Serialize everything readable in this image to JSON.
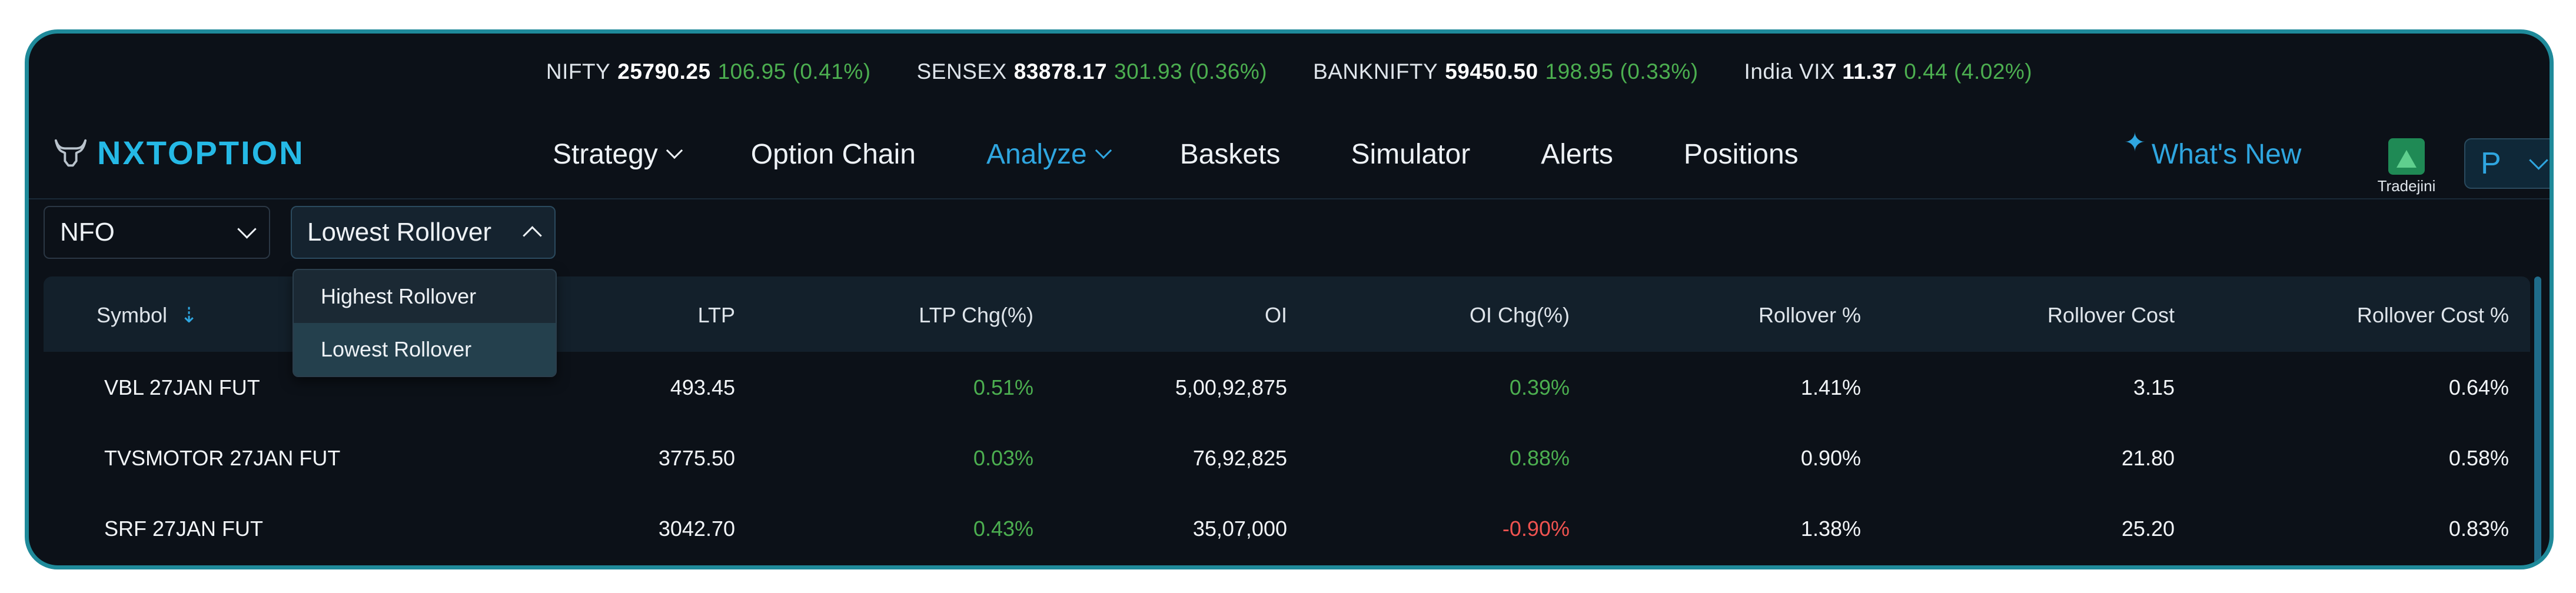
{
  "ticker": [
    {
      "name": "NIFTY",
      "value": "25790.25",
      "change": "106.95 (0.41%)"
    },
    {
      "name": "SENSEX",
      "value": "83878.17",
      "change": "301.93 (0.36%)"
    },
    {
      "name": "BANKNIFTY",
      "value": "59450.50",
      "change": "198.95 (0.33%)"
    },
    {
      "name": "India VIX",
      "value": "11.37",
      "change": "0.44 (4.02%)"
    }
  ],
  "logo": {
    "text": "NXTOPTION"
  },
  "nav": [
    {
      "label": "Strategy",
      "dropdown": true
    },
    {
      "label": "Option Chain",
      "dropdown": false
    },
    {
      "label": "Analyze",
      "dropdown": true,
      "active": true
    },
    {
      "label": "Baskets",
      "dropdown": false
    },
    {
      "label": "Simulator",
      "dropdown": false
    },
    {
      "label": "Alerts",
      "dropdown": false
    },
    {
      "label": "Positions",
      "dropdown": false
    }
  ],
  "whats_new": "What's New",
  "broker": {
    "label": "Tradejini"
  },
  "profile": {
    "initial": "P"
  },
  "filters": {
    "exchange": "NFO",
    "rollover": "Lowest Rollover",
    "rollover_options": [
      "Highest Rollover",
      "Lowest Rollover"
    ],
    "rollover_selected_index": 1
  },
  "table": {
    "columns": [
      "Symbol",
      "LTP",
      "LTP Chg(%)",
      "OI",
      "OI Chg(%)",
      "Rollover %",
      "Rollover Cost",
      "Rollover Cost %"
    ],
    "rows": [
      {
        "symbol": "VBL 27JAN FUT",
        "ltp": "493.45",
        "ltp_chg": "0.51%",
        "oi": "5,00,92,875",
        "oi_chg": "0.39%",
        "rollover": "1.41%",
        "rollover_cost": "3.15",
        "rollover_cost_pct": "0.64%"
      },
      {
        "symbol": "TVSMOTOR 27JAN FUT",
        "ltp": "3775.50",
        "ltp_chg": "0.03%",
        "oi": "76,92,825",
        "oi_chg": "0.88%",
        "rollover": "0.90%",
        "rollover_cost": "21.80",
        "rollover_cost_pct": "0.58%"
      },
      {
        "symbol": "SRF 27JAN FUT",
        "ltp": "3042.70",
        "ltp_chg": "0.43%",
        "oi": "35,07,000",
        "oi_chg": "-0.90%",
        "rollover": "1.38%",
        "rollover_cost": "25.20",
        "rollover_cost_pct": "0.83%"
      }
    ]
  },
  "colors": {
    "accent": "#2fa6e0",
    "positive": "#4caf50",
    "negative": "#ef5350",
    "background": "#0c1118",
    "frame": "#1f8a9a"
  }
}
